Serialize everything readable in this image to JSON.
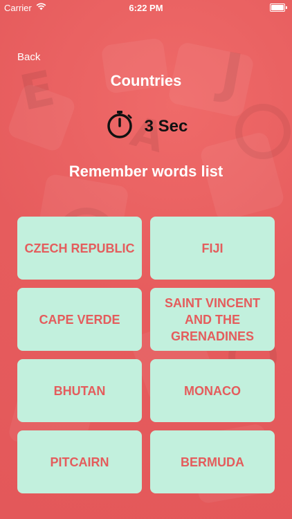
{
  "status_bar": {
    "carrier": "Carrier",
    "time": "6:22 PM"
  },
  "nav": {
    "back_label": "Back"
  },
  "title": "Countries",
  "timer": {
    "label": "3 Sec"
  },
  "subtitle": "Remember words list",
  "words": [
    "CZECH REPUBLIC",
    "FIJI",
    "CAPE VERDE",
    "SAINT VINCENT AND THE GRENADINES",
    "BHUTAN",
    "MONACO",
    "PITCAIRN",
    "BERMUDA"
  ],
  "colors": {
    "background": "#e8585a",
    "card": "#c2f0dd",
    "card_text": "#e45c5c",
    "text": "#ffffff"
  }
}
